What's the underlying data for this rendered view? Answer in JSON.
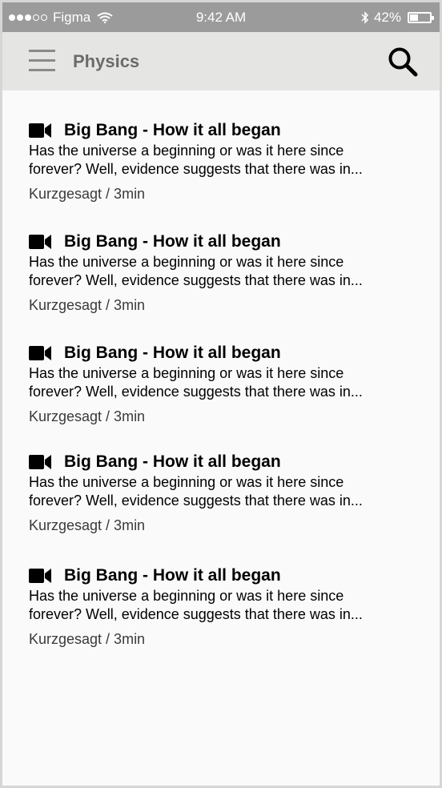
{
  "status_bar": {
    "carrier": "Figma",
    "time": "9:42 AM",
    "battery_percent": "42%",
    "battery_level": 0.42,
    "signal_bars_filled": 3,
    "signal_bars_total": 5,
    "icons": [
      "wifi-icon",
      "bluetooth-icon",
      "battery-icon"
    ]
  },
  "header": {
    "title": "Physics",
    "menu_icon": "hamburger-menu-icon",
    "search_icon": "search-icon"
  },
  "colors": {
    "status_bar_bg": "#9b9b9b",
    "header_bg": "#e5e5e4",
    "title_color": "#6b6b6b",
    "content_bg": "#fafafa"
  },
  "items": [
    {
      "icon": "video-camera-icon",
      "title": "Big Bang - How it all began",
      "description_line1": "Has the universe a beginning or was it here since",
      "description_line2": "forever? Well, evidence suggests that there was in...",
      "meta": "Kurzgesagt / 3min"
    },
    {
      "icon": "video-camera-icon",
      "title": "Big Bang - How it all began",
      "description_line1": "Has the universe a beginning or was it here since",
      "description_line2": "forever? Well, evidence suggests that there was in...",
      "meta": "Kurzgesagt / 3min"
    },
    {
      "icon": "video-camera-icon",
      "title": "Big Bang - How it all began",
      "description_line1": "Has the universe a beginning or was it here since",
      "description_line2": "forever? Well, evidence suggests that there was in...",
      "meta": "Kurzgesagt / 3min"
    },
    {
      "icon": "video-camera-icon",
      "title": "Big Bang - How it all began",
      "description_line1": "Has the universe a beginning or was it here since",
      "description_line2": "forever? Well, evidence suggests that there was in...",
      "meta": "Kurzgesagt / 3min"
    },
    {
      "icon": "video-camera-icon",
      "title": "Big Bang - How it all began",
      "description_line1": "Has the universe a beginning or was it here since",
      "description_line2": "forever? Well, evidence suggests that there was in...",
      "meta": "Kurzgesagt / 3min"
    }
  ]
}
